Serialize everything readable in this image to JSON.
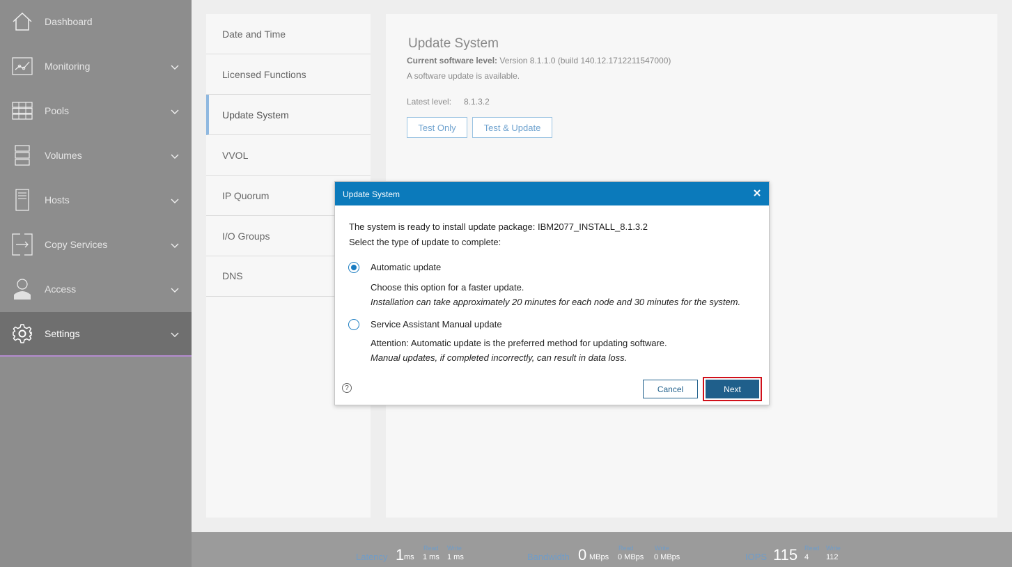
{
  "sidebar": {
    "items": [
      {
        "label": "Dashboard",
        "icon": "house-icon"
      },
      {
        "label": "Monitoring",
        "icon": "monitoring-icon"
      },
      {
        "label": "Pools",
        "icon": "pools-icon"
      },
      {
        "label": "Volumes",
        "icon": "volumes-icon"
      },
      {
        "label": "Hosts",
        "icon": "hosts-icon"
      },
      {
        "label": "Copy Services",
        "icon": "copy-services-icon"
      },
      {
        "label": "Access",
        "icon": "user-icon"
      },
      {
        "label": "Settings",
        "icon": "gear-icon",
        "active": true
      }
    ]
  },
  "settings_menu": {
    "items": [
      "Date and Time",
      "Licensed Functions",
      "Update System",
      "VVOL",
      "IP Quorum",
      "I/O Groups",
      "DNS"
    ],
    "active": "Update System"
  },
  "content": {
    "title": "Update System",
    "current_level_label": "Current software level:",
    "current_level_value": "Version 8.1.1.0 (build 140.12.1712211547000)",
    "available_text": "A software update is available.",
    "latest_label": "Latest level:",
    "latest_value": "8.1.3.2",
    "test_only_label": "Test Only",
    "test_update_label": "Test & Update"
  },
  "modal": {
    "title": "Update System",
    "ready_text": "The system is ready to install update package: IBM2077_INSTALL_8.1.3.2",
    "select_text": "Select the type of update to complete:",
    "option_auto": "Automatic update",
    "auto_desc1": "Choose this option for a faster update.",
    "auto_desc2": "Installation can take approximately 20 minutes for each node and 30 minutes for the system.",
    "option_manual": "Service Assistant Manual update",
    "manual_desc1": "Attention: Automatic update is the preferred method for updating software.",
    "manual_desc2": "Manual updates, if completed incorrectly, can result in data loss.",
    "selected": "Automatic update",
    "help_glyph": "?",
    "cancel_label": "Cancel",
    "next_label": "Next"
  },
  "footer": {
    "latency": {
      "label": "Latency",
      "value": "1",
      "unit": "ms",
      "read_label": "Read",
      "read_value": "1 ms",
      "write_label": "Write",
      "write_value": "1 ms"
    },
    "bandwidth": {
      "label": "Bandwidth",
      "value": "0",
      "unit": "MBps",
      "read_label": "Read",
      "read_value": "0 MBps",
      "write_label": "Write",
      "write_value": "0 MBps"
    },
    "iops": {
      "label": "IOPS",
      "value": "115",
      "read_label": "Read",
      "read_value": "4",
      "write_label": "Write",
      "write_value": "112"
    }
  },
  "colors": {
    "sidebar_bg": "#8d8d8d",
    "modal_header": "#0b7abb",
    "primary_button": "#1f5f8b",
    "highlight_border": "#d0101a",
    "accent_link": "#6f9cc9"
  }
}
